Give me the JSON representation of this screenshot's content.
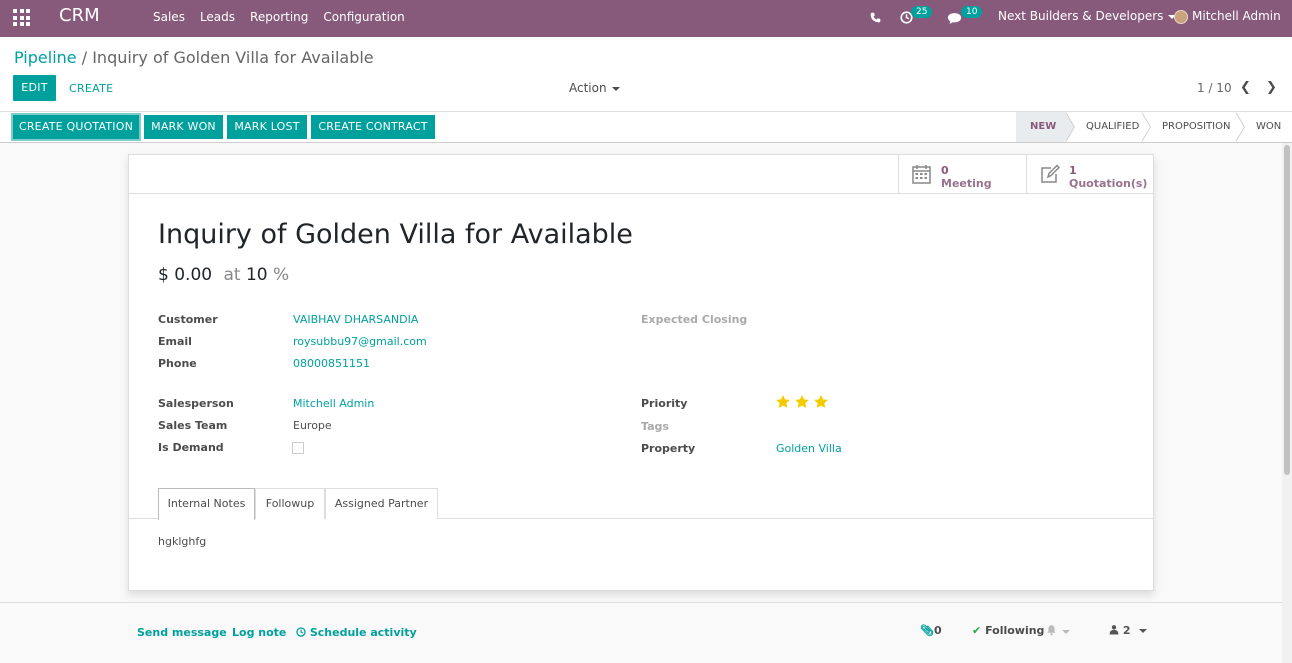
{
  "navbar": {
    "app_name": "CRM",
    "menu": [
      "Sales",
      "Leads",
      "Reporting",
      "Configuration"
    ],
    "activity_count": "25",
    "message_count": "10",
    "company": "Next Builders & Developers",
    "user": "Mitchell Admin"
  },
  "breadcrumb": {
    "parent": "Pipeline",
    "separator": "/",
    "current": "Inquiry of Golden Villa for Available"
  },
  "controls": {
    "edit": "EDIT",
    "create": "CREATE",
    "action": "Action",
    "pager": "1 / 10"
  },
  "statusbar": {
    "buttons": [
      "CREATE QUOTATION",
      "MARK WON",
      "MARK LOST",
      "CREATE CONTRACT"
    ],
    "stages": [
      "NEW",
      "QUALIFIED",
      "PROPOSITION",
      "WON"
    ],
    "active_stage": "NEW"
  },
  "smart_buttons": [
    {
      "value": "0",
      "label": "Meeting",
      "icon": "calendar-icon"
    },
    {
      "value": "1",
      "label": "Quotation(s)",
      "icon": "edit-icon"
    }
  ],
  "record": {
    "title": "Inquiry of Golden Villa for Available",
    "revenue": "$ 0.00",
    "at_label": "at",
    "probability": "10",
    "percent": "%"
  },
  "fields": {
    "customer_label": "Customer",
    "customer": "VAIBHAV DHARSANDIA",
    "email_label": "Email",
    "email": "roysubbu97@gmail.com",
    "phone_label": "Phone",
    "phone": "08000851151",
    "salesperson_label": "Salesperson",
    "salesperson": "Mitchell Admin",
    "team_label": "Sales Team",
    "team": "Europe",
    "demand_label": "Is Demand",
    "is_demand": false,
    "closing_label": "Expected Closing",
    "priority_label": "Priority",
    "priority_stars": 3,
    "tags_label": "Tags",
    "property_label": "Property",
    "property": "Golden Villa"
  },
  "tabs": [
    "Internal Notes",
    "Followup",
    "Assigned Partner"
  ],
  "notes": "hgklghfg",
  "chatter": {
    "send_message": "Send message",
    "log_note": "Log note",
    "schedule_activity": "Schedule activity",
    "attachments": "0",
    "following": "Following",
    "followers": "2"
  },
  "colors": {
    "brand": "#875a7b",
    "accent": "#00a09d",
    "star": "#f3cc00"
  }
}
